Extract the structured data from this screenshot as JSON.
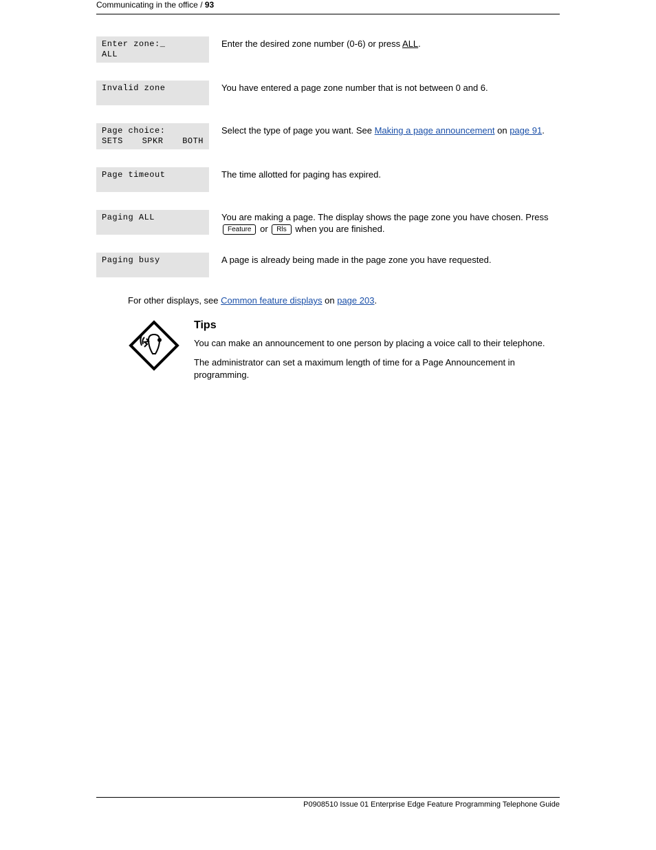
{
  "header": {
    "left_text": "Communicating in the office / ",
    "left_page": "93"
  },
  "rows": [
    {
      "lcd": {
        "line1": "Enter zone:_",
        "line2": "ALL"
      },
      "desc_prefix": "Enter the desired zone number (0-6) or press ",
      "literal": "ALL",
      "desc_suffix": "."
    },
    {
      "lcd": {
        "line1": "Invalid zone",
        "line2": ""
      },
      "desc": "You have entered a page zone number that is not between 0 and 6."
    },
    {
      "lcd": {
        "line1": "Page choice:",
        "three": [
          "SETS",
          "  SPKR",
          "BOTH"
        ]
      },
      "desc_prefix": "Select the type of page you want. See ",
      "link_text": "Making a page announcement",
      "link_suffix": " on ",
      "page_ref_link": "page 91",
      "desc_suffix2": "."
    },
    {
      "lcd": {
        "line1": "Page timeout",
        "line2": ""
      },
      "desc": "The time allotted for paging has expired."
    },
    {
      "lcd": {
        "line1": "Paging ALL",
        "line2": ""
      },
      "desc_prefix": "You are making a page. The display shows the page zone you have chosen. Press ",
      "key1": "Feature",
      "desc_mid": " or ",
      "key2": "Rls",
      "desc_suffix": " when you are finished."
    },
    {
      "lcd": {
        "line1": "Paging busy",
        "line2": ""
      },
      "desc": "A page is already being made in the page zone you have requested."
    }
  ],
  "also": {
    "prefix": "For other displays, see ",
    "link": "Common feature displays",
    "suffix_prefix": " on ",
    "page_link": "page 203",
    "suffix": "."
  },
  "tips": {
    "title": "Tips",
    "p1": "You can make an announcement to one person by placing a voice call to their telephone.",
    "p2": "The administrator can set a maximum length of time for a Page Announcement in programming."
  },
  "footer": {
    "text": "P0908510 Issue 01    Enterprise Edge Feature Programming Telephone Guide"
  }
}
